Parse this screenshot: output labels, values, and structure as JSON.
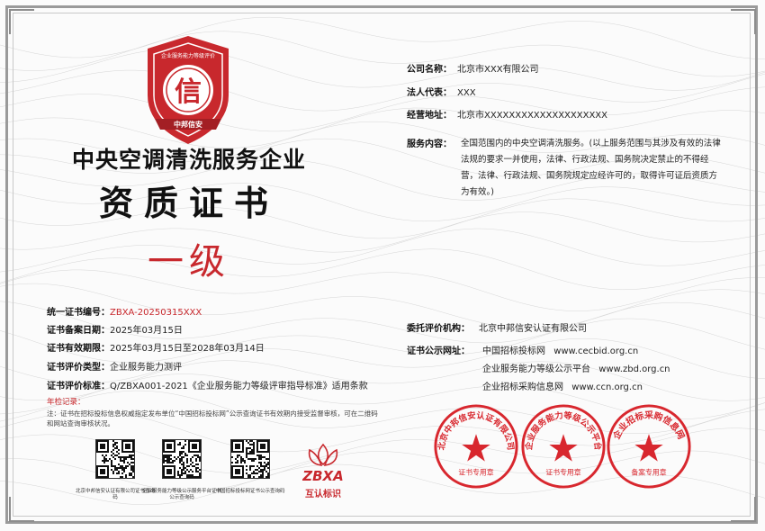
{
  "emblem": {
    "ring_text": "企业服务能力等级评价",
    "center_char": "信",
    "ribbon_text": "中邦信安"
  },
  "titles": {
    "line1": "中央空调清洗服务企业",
    "line2": "资质证书",
    "level": "一级"
  },
  "left_fields": [
    {
      "label": "统一证书编号：",
      "value": "ZBXA-20250315XXX",
      "highlight": true
    },
    {
      "label": "证书备案日期：",
      "value": "2025年03月15日",
      "highlight": false
    },
    {
      "label": "证书有效期限：",
      "value": "2025年03月15日至2028年03月14日",
      "highlight": false
    },
    {
      "label": "证书评价类型：",
      "value": "企业服务能力测评",
      "highlight": false
    },
    {
      "label": "证书评价标准：",
      "value": "Q/ZBXA001-2021《企业服务能力等级评审指导标准》适用条款",
      "highlight": false
    }
  ],
  "notes": {
    "title": "年检记录：",
    "text": "注：证书在招标投标信息权威指定发布单位“中国招标投标网”公示查询证书有效期内接受监督审核，可在二维码和网站查询审核状况。"
  },
  "qr_codes": [
    {
      "caption": "北京中邦信安认证有限公司证书查询码"
    },
    {
      "caption": "企业服务能力等级公示服务平台证书公示查询码"
    },
    {
      "caption": "中国招标投标网证书公示查询码"
    }
  ],
  "brand": {
    "text": "互认标识",
    "mark": "ZBXA"
  },
  "company": [
    {
      "label": "公司名称：",
      "value": "北京市XXX有限公司"
    },
    {
      "label": "法人代表：",
      "value": "XXX"
    },
    {
      "label": "经营地址：",
      "value": "北京市XXXXXXXXXXXXXXXXXXXX"
    }
  ],
  "scope": {
    "label": "服务内容：",
    "text": "全国范围内的中央空调清洗服务。(以上服务范围与其涉及有效的法律法规的要求一并使用，法律、行政法规、国务院决定禁止的不得经营，法律、行政法规、国务院规定应经许可的，取得许可证后资质方为有效。)"
  },
  "agency": {
    "label": "委托评价机构：",
    "value": "北京中邦信安认证有限公司"
  },
  "publication": {
    "label": "证书公示网址：",
    "lines": [
      {
        "name": "中国招标投标网",
        "url": "www.cecbid.org.cn"
      },
      {
        "name": "企业服务能力等级公示平台",
        "url": "www.zbd.org.cn"
      },
      {
        "name": "企业招标采购信息网",
        "url": "www.ccn.org.cn"
      }
    ]
  },
  "seals": [
    {
      "text": "北京中邦信安认证有限公司",
      "bottom": "证书专用章"
    },
    {
      "text": "企业服务能力等级公示平台",
      "bottom": "证书专用章"
    },
    {
      "text": "企业招标采购信息网",
      "bottom": "备案专用章"
    }
  ],
  "colors": {
    "accent": "#c8282d",
    "ink": "#111111",
    "frame": "#9a9a9a"
  }
}
